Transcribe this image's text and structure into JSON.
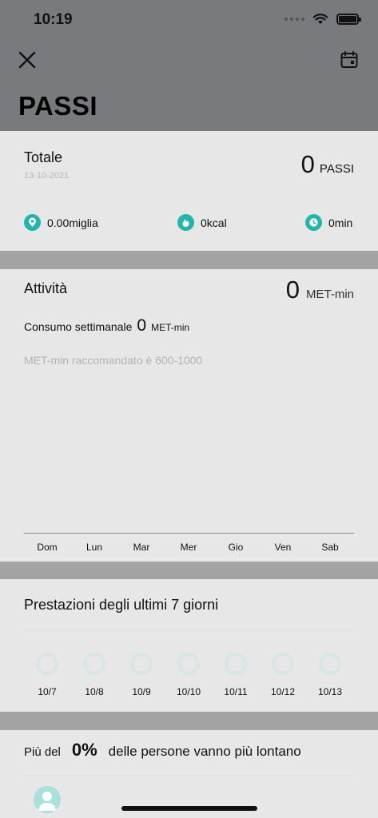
{
  "status_bar": {
    "time": "10:19"
  },
  "header": {
    "title": "PASSI",
    "close_icon": "close-icon",
    "calendar_icon": "calendar-icon"
  },
  "totals": {
    "label": "Totale",
    "date": "13-10-2021",
    "steps_value": "0",
    "steps_unit": "PASSI",
    "distance": "0.00miglia",
    "calories": "0kcal",
    "duration": "0min"
  },
  "activity": {
    "label": "Attività",
    "met_value": "0",
    "met_unit": "MET-min",
    "weekly_label": "Consumo settimanale",
    "weekly_value": "0",
    "weekly_unit": "MET-min",
    "recommended": "MET-min raccomandato è 600-1000",
    "days": [
      "Dom",
      "Lun",
      "Mar",
      "Mer",
      "Gio",
      "Ven",
      "Sab"
    ]
  },
  "performance": {
    "label": "Prestazioni degli ultimi 7 giorni",
    "dates": [
      "10/7",
      "10/8",
      "10/9",
      "10/10",
      "10/11",
      "10/12",
      "10/13"
    ]
  },
  "comparison": {
    "prefix": "Più del",
    "percent": "0%",
    "suffix": "delle persone vanno più lontano"
  },
  "colors": {
    "accent": "#22b5ad",
    "header_bg": "#797a7d",
    "card_bg": "#e6e7e6"
  }
}
